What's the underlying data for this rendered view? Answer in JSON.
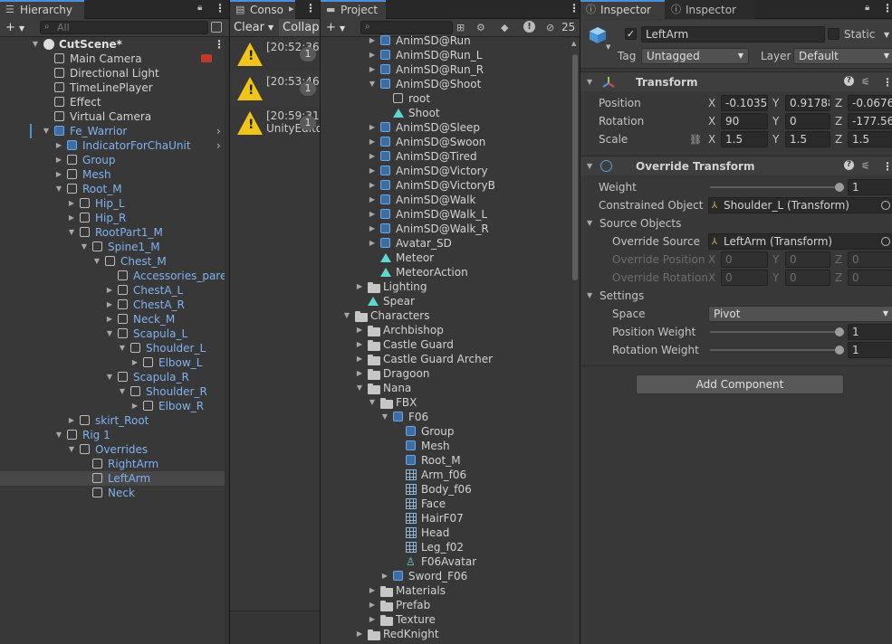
{
  "hierarchy": {
    "tab_label": "Hierarchy",
    "search_placeholder": "All",
    "add_label": "+",
    "rows": [
      {
        "label": "CutScene*"
      },
      {
        "label": "Main Camera"
      },
      {
        "label": "Directional Light"
      },
      {
        "label": "TimeLinePlayer"
      },
      {
        "label": "Effect"
      },
      {
        "label": "Virtual Camera"
      },
      {
        "label": "Fe_Warrior"
      },
      {
        "label": "IndicatorForChaUnit"
      },
      {
        "label": "Group"
      },
      {
        "label": "Mesh"
      },
      {
        "label": "Root_M"
      },
      {
        "label": "Hip_L"
      },
      {
        "label": "Hip_R"
      },
      {
        "label": "RootPart1_M"
      },
      {
        "label": "Spine1_M"
      },
      {
        "label": "Chest_M"
      },
      {
        "label": "Accessories_parent"
      },
      {
        "label": "ChestA_L"
      },
      {
        "label": "ChestA_R"
      },
      {
        "label": "Neck_M"
      },
      {
        "label": "Scapula_L"
      },
      {
        "label": "Shoulder_L"
      },
      {
        "label": "Elbow_L"
      },
      {
        "label": "Scapula_R"
      },
      {
        "label": "Shoulder_R"
      },
      {
        "label": "Elbow_R"
      },
      {
        "label": "skirt_Root"
      },
      {
        "label": "Rig 1"
      },
      {
        "label": "Overrides"
      },
      {
        "label": "RightArm"
      },
      {
        "label": "LeftArm"
      },
      {
        "label": "Neck"
      }
    ]
  },
  "console": {
    "tab_label": "Conso",
    "clear_label": "Clear",
    "collapse_label": "Collaps",
    "entries": [
      {
        "time": "[20:52:36]",
        "count": "1",
        "detail": ""
      },
      {
        "time": "[20:53:46]",
        "count": "1",
        "detail": ""
      },
      {
        "time": "[20:59:31]",
        "count": "1",
        "detail": "UnityEdito"
      }
    ]
  },
  "project": {
    "tab_label": "Project",
    "add_label": "+",
    "hidden_count": "25",
    "rows": [
      {
        "label": "AnimSD@Run"
      },
      {
        "label": "AnimSD@Run_L"
      },
      {
        "label": "AnimSD@Run_R"
      },
      {
        "label": "AnimSD@Shoot"
      },
      {
        "label": "root"
      },
      {
        "label": "Shoot"
      },
      {
        "label": "AnimSD@Sleep"
      },
      {
        "label": "AnimSD@Swoon"
      },
      {
        "label": "AnimSD@Tired"
      },
      {
        "label": "AnimSD@Victory"
      },
      {
        "label": "AnimSD@VictoryB"
      },
      {
        "label": "AnimSD@Walk"
      },
      {
        "label": "AnimSD@Walk_L"
      },
      {
        "label": "AnimSD@Walk_R"
      },
      {
        "label": "Avatar_SD"
      },
      {
        "label": "Meteor"
      },
      {
        "label": "MeteorAction"
      },
      {
        "label": "Lighting"
      },
      {
        "label": "Spear"
      },
      {
        "label": "Characters"
      },
      {
        "label": "Archbishop"
      },
      {
        "label": "Castle Guard"
      },
      {
        "label": "Castle Guard Archer"
      },
      {
        "label": "Dragoon"
      },
      {
        "label": "Nana"
      },
      {
        "label": "FBX"
      },
      {
        "label": "F06"
      },
      {
        "label": "Group"
      },
      {
        "label": "Mesh"
      },
      {
        "label": "Root_M"
      },
      {
        "label": "Arm_f06"
      },
      {
        "label": "Body_f06"
      },
      {
        "label": "Face"
      },
      {
        "label": "HairF07"
      },
      {
        "label": "Head"
      },
      {
        "label": "Leg_f02"
      },
      {
        "label": "F06Avatar"
      },
      {
        "label": "Sword_F06"
      },
      {
        "label": "Materials"
      },
      {
        "label": "Prefab"
      },
      {
        "label": "Texture"
      },
      {
        "label": "RedKnight"
      }
    ]
  },
  "inspector": {
    "tab1_label": "Inspector",
    "tab2_label": "Inspector",
    "object_name": "LeftArm",
    "static_label": "Static",
    "tag_label": "Tag",
    "tag_value": "Untagged",
    "layer_label": "Layer",
    "layer_value": "Default",
    "transform": {
      "title": "Transform",
      "position_label": "Position",
      "rotation_label": "Rotation",
      "scale_label": "Scale",
      "position": {
        "x": "-0.1035",
        "y": "0.91788",
        "z": "-0.0676"
      },
      "rotation": {
        "x": "90",
        "y": "0",
        "z": "-177.562"
      },
      "scale": {
        "x": "1.5",
        "y": "1.5",
        "z": "1.5"
      }
    },
    "override": {
      "title": "Override Transform",
      "weight_label": "Weight",
      "weight_value": "1",
      "constrained_label": "Constrained Object",
      "constrained_value": "Shoulder_L (Transform)",
      "source_objects_label": "Source Objects",
      "override_source_label": "Override Source",
      "override_source_value": "LeftArm (Transform)",
      "override_position_label": "Override Position",
      "override_rotation_label": "Override Rotation",
      "op": {
        "x": "0",
        "y": "0",
        "z": "0"
      },
      "or": {
        "x": "0",
        "y": "0",
        "z": "0"
      },
      "settings_label": "Settings",
      "space_label": "Space",
      "space_value": "Pivot",
      "position_weight_label": "Position Weight",
      "position_weight_value": "1",
      "rotation_weight_label": "Rotation Weight",
      "rotation_weight_value": "1"
    },
    "axis": {
      "x": "X",
      "y": "Y",
      "z": "Z"
    },
    "add_component_label": "Add Component"
  }
}
